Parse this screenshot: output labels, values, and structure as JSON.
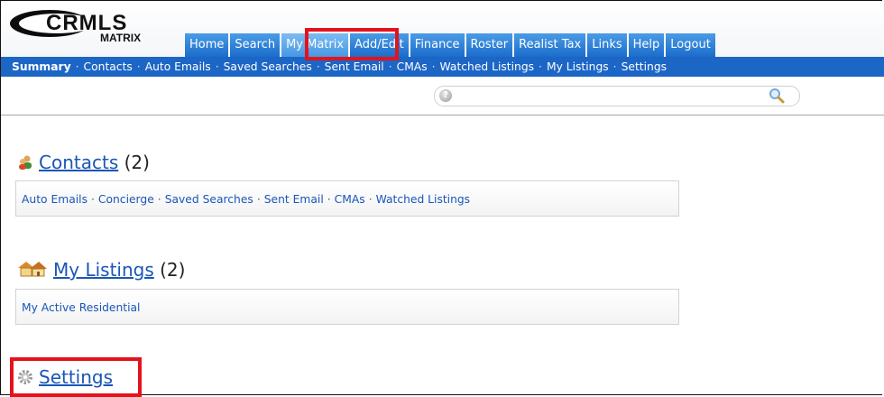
{
  "logo": {
    "brand": "CRMLS",
    "product": "MATRIX"
  },
  "nav": {
    "tabs": [
      {
        "label": "Home"
      },
      {
        "label": "Search"
      },
      {
        "label": "My Matrix",
        "active": true
      },
      {
        "label": "Add/Edit"
      },
      {
        "label": "Finance"
      },
      {
        "label": "Roster"
      },
      {
        "label": "Realist Tax"
      },
      {
        "label": "Links"
      },
      {
        "label": "Help"
      },
      {
        "label": "Logout"
      }
    ]
  },
  "subnav": {
    "items": [
      {
        "label": "Summary",
        "current": true
      },
      {
        "label": "Contacts"
      },
      {
        "label": "Auto Emails"
      },
      {
        "label": "Saved Searches"
      },
      {
        "label": "Sent Email"
      },
      {
        "label": "CMAs"
      },
      {
        "label": "Watched Listings"
      },
      {
        "label": "My Listings"
      },
      {
        "label": "Settings"
      }
    ],
    "separator": "·"
  },
  "search": {
    "value": "",
    "placeholder": ""
  },
  "sections": {
    "contacts": {
      "title": "Contacts",
      "count": "(2)",
      "icon": "contacts-icon",
      "links": [
        "Auto Emails",
        "Concierge",
        "Saved Searches",
        "Sent Email",
        "CMAs",
        "Watched Listings"
      ]
    },
    "my_listings": {
      "title": "My Listings",
      "count": "(2)",
      "icon": "house-icon",
      "links": [
        "My Active Residential"
      ]
    },
    "settings": {
      "title": "Settings",
      "icon": "gear-icon"
    }
  },
  "colors": {
    "nav_tab": "#1b6dcb",
    "subnav_bg": "#1c66c6",
    "link": "#1a56b8",
    "highlight": "#e4131b"
  }
}
